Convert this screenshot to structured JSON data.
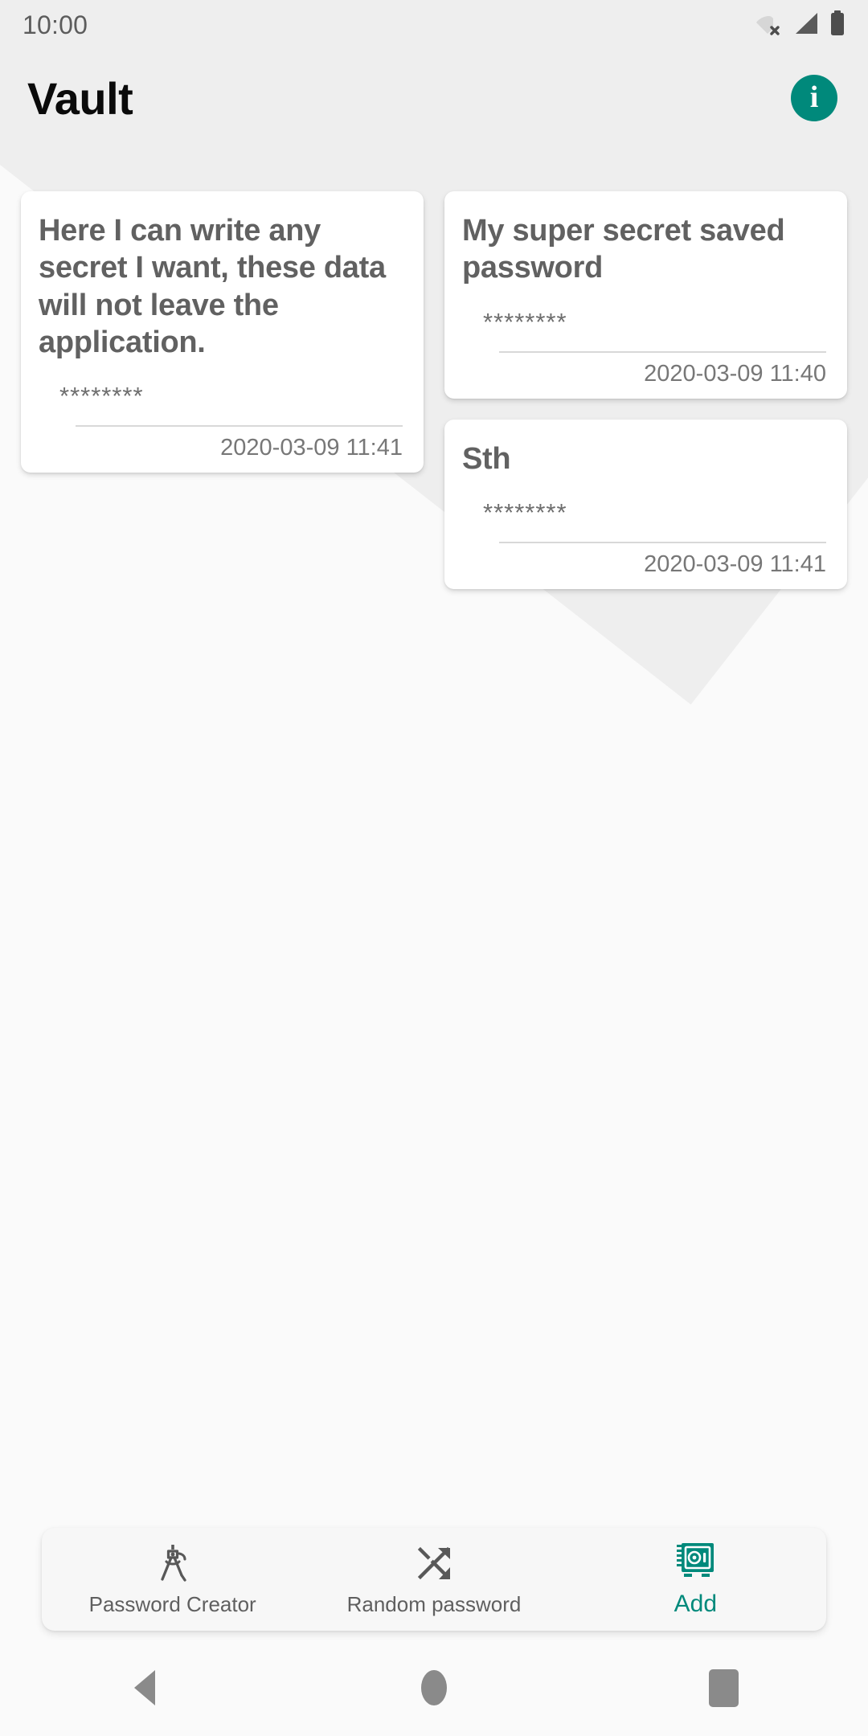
{
  "status_bar": {
    "time": "10:00",
    "icons": [
      "wifi-off-icon",
      "cellular-signal-icon",
      "battery-full-icon"
    ]
  },
  "app_bar": {
    "title": "Vault",
    "info_button": {
      "icon": "info-icon",
      "glyph": "i",
      "color": "#00897b"
    }
  },
  "colors": {
    "accent": "#00897b",
    "background": "#fafafa",
    "band": "#eeeeee",
    "card": "#ffffff",
    "title_text": "#616161",
    "secondary_text": "#777777"
  },
  "cards": {
    "left_column": [
      {
        "title": "Here I can write any secret I want, these data will not leave the application.",
        "secret": "********",
        "date": "2020-03-09 11:41"
      }
    ],
    "right_column": [
      {
        "title": "My super secret saved password",
        "secret": "********",
        "date": "2020-03-09 11:40"
      },
      {
        "title": "Sth",
        "secret": "********",
        "date": "2020-03-09 11:41"
      }
    ]
  },
  "bottom_nav": {
    "items": [
      {
        "label": "Password Creator",
        "icon": "compass-icon",
        "active": false
      },
      {
        "label": "Random password",
        "icon": "shuffle-icon",
        "active": false
      },
      {
        "label": "Add",
        "icon": "safe-vault-icon",
        "active": true
      }
    ]
  },
  "system_nav": {
    "back": "back-icon",
    "home": "home-icon",
    "recents": "recents-icon"
  }
}
